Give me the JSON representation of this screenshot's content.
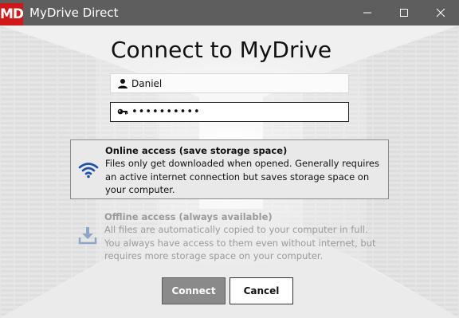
{
  "window": {
    "logo_text": "MD",
    "title": "MyDrive Direct"
  },
  "heading": "Connect to MyDrive",
  "username": {
    "value": "Daniel",
    "icon": "user-icon"
  },
  "password": {
    "value": "••••••••••",
    "icon": "key-icon"
  },
  "options": {
    "online": {
      "title": "Online access (save storage space)",
      "description": "Files only get downloaded when opened. Generally requires an active internet connection but saves storage space on your computer.",
      "icon": "wifi-icon",
      "selected": true
    },
    "offline": {
      "title": "Offline access (always available)",
      "description": "All files are automatically copied to your computer in full. You always have access to them even without internet, but requires more storage space on your computer.",
      "icon": "download-icon",
      "selected": false
    }
  },
  "buttons": {
    "connect": "Connect",
    "cancel": "Cancel"
  },
  "colors": {
    "titlebar": "#5e5e5e",
    "logo": "#d01818",
    "accent_blue": "#1c4fa8"
  }
}
